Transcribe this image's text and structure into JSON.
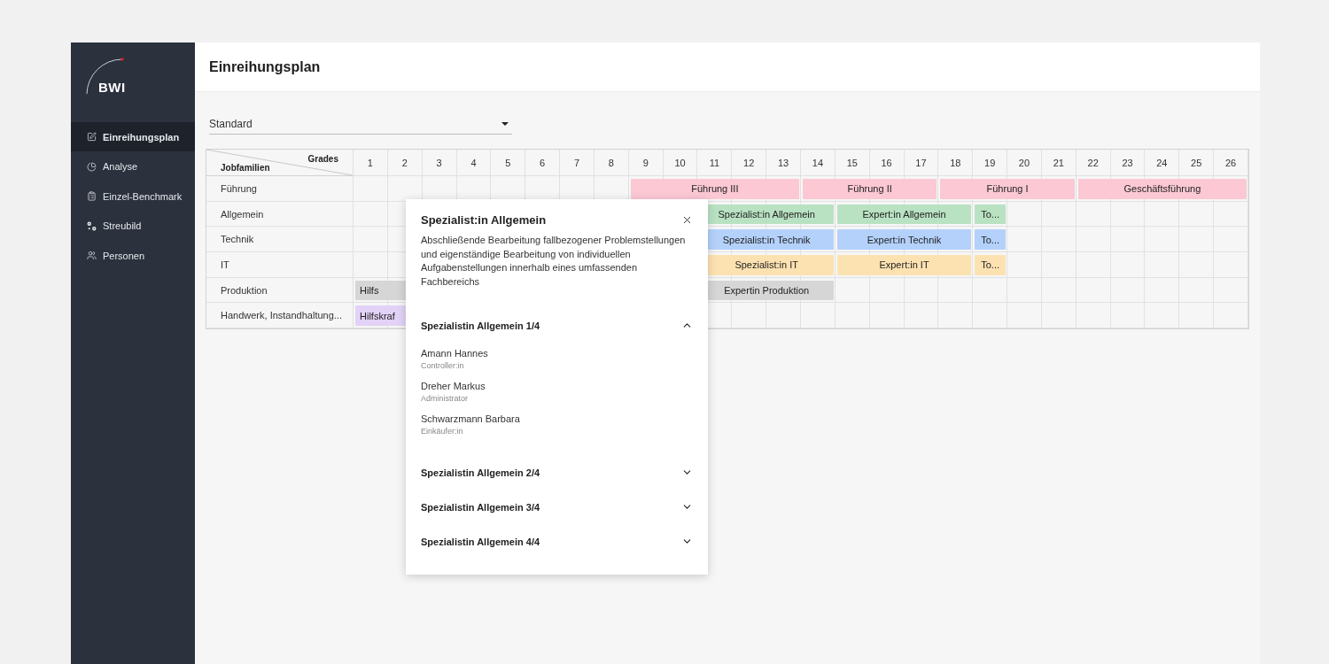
{
  "sidebar": {
    "logo": "BWI",
    "items": [
      {
        "label": "Einreihungsplan",
        "selected": true
      },
      {
        "label": "Analyse",
        "selected": false
      },
      {
        "label": "Einzel-Benchmark",
        "selected": false
      },
      {
        "label": "Streubild",
        "selected": false
      },
      {
        "label": "Personen",
        "selected": false
      }
    ]
  },
  "header": {
    "title": "Einreihungsplan"
  },
  "selector": {
    "value": "Standard"
  },
  "plan": {
    "corner_top": "Grades",
    "corner_bottom": "Jobfamilien",
    "grades": [
      "1",
      "2",
      "3",
      "4",
      "5",
      "6",
      "7",
      "8",
      "9",
      "10",
      "11",
      "12",
      "13",
      "14",
      "15",
      "16",
      "17",
      "18",
      "19",
      "20",
      "21",
      "22",
      "23",
      "24",
      "25",
      "26"
    ],
    "rows": [
      {
        "label": "Führung",
        "bands": [
          {
            "label": "Führung III",
            "color": "#fbc8d4"
          },
          {
            "label": "Führung II",
            "color": "#fbc8d4"
          },
          {
            "label": "Führung I",
            "color": "#fbc8d4"
          },
          {
            "label": "Geschäftsführung",
            "color": "#fbc8d4"
          }
        ]
      },
      {
        "label": "Allgemein",
        "bands": [
          {
            "label": "Spezialist:in Allgemein",
            "color": "#b9e2c2"
          },
          {
            "label": "Expert:in Allgemein",
            "color": "#b9e2c2"
          },
          {
            "label": "To...",
            "color": "#b9e2c2"
          }
        ]
      },
      {
        "label": "Technik",
        "bands": [
          {
            "label": "Spezialist:in Technik",
            "color": "#b3d1fb"
          },
          {
            "label": "Expert:in Technik",
            "color": "#b3d1fb"
          },
          {
            "label": "To...",
            "color": "#b3d1fb"
          }
        ]
      },
      {
        "label": "IT",
        "bands": [
          {
            "label": "Spezialist:in IT",
            "color": "#fde2b1"
          },
          {
            "label": "Expert:in IT",
            "color": "#fde2b1"
          },
          {
            "label": "To...",
            "color": "#fde2b1"
          }
        ]
      },
      {
        "label": "Produktion",
        "bands": [
          {
            "label": "Hilfs",
            "color": "#d6d6d6"
          },
          {
            "label": "Expertin Produktion",
            "color": "#d6d6d6"
          }
        ]
      },
      {
        "label": "Handwerk, Instandhaltung...",
        "bands": [
          {
            "label": "Hilfskraf",
            "color": "#e2d2f7"
          }
        ]
      }
    ]
  },
  "popover": {
    "title": "Spezialist:in Allgemein",
    "description": "Abschließende Bearbeitung fallbezogener Problemstellungen und eigenständige Bearbeitung von individuellen Aufgabenstellungen innerhalb eines umfassenden Fachbereichs",
    "groups": [
      {
        "title": "Spezialistin Allgemein 1/4",
        "expanded": true,
        "people": [
          {
            "name": "Amann Hannes",
            "role": "Controller:in"
          },
          {
            "name": "Dreher Markus",
            "role": "Administrator"
          },
          {
            "name": "Schwarzmann Barbara",
            "role": "Einkäufer:in"
          }
        ]
      },
      {
        "title": "Spezialistin Allgemein 2/4",
        "expanded": false
      },
      {
        "title": "Spezialistin Allgemein 3/4",
        "expanded": false
      },
      {
        "title": "Spezialistin Allgemein 4/4",
        "expanded": false
      }
    ]
  }
}
